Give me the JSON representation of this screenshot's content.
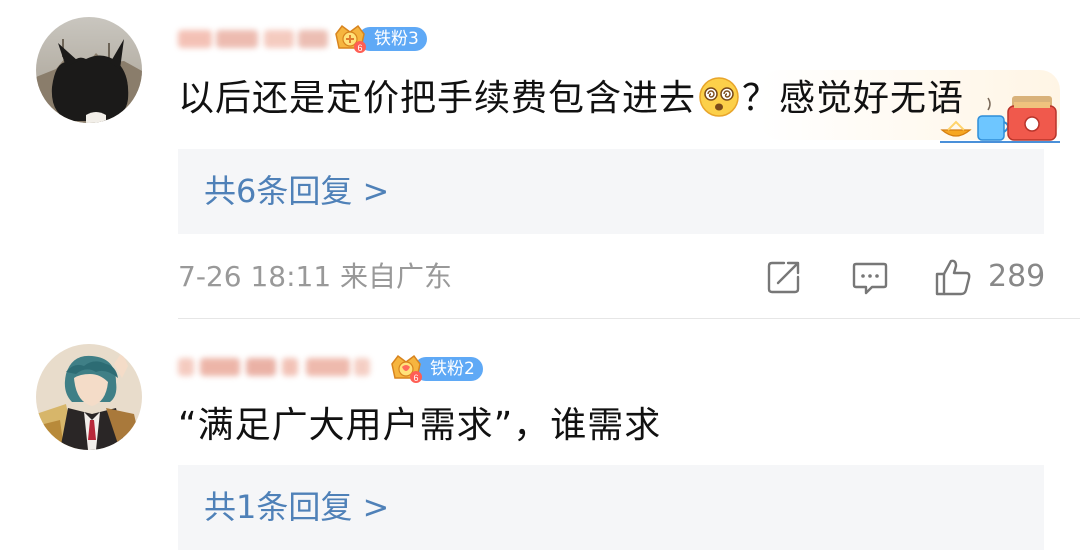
{
  "comments": [
    {
      "fan_badge": "铁粉3",
      "text_before": "以后还是定价把手续费包含进去",
      "text_after": "？感觉好无语",
      "emoji": "dizzy-face-emoji",
      "reply_link": "共6条回复 >",
      "timestamp": "7-26 18:11 来自广东",
      "like_count": "289"
    },
    {
      "fan_badge": "铁粉2",
      "text": "“满足广大用户需求”，谁需求",
      "reply_link": "共1条回复 >"
    }
  ],
  "colors": {
    "link": "#4f81b8",
    "badge": "#5fa9f6",
    "meta": "#999999",
    "reply_bg": "#f5f6f8"
  },
  "icons": [
    "crown-badge-icon",
    "forward-icon",
    "comment-icon",
    "like-icon",
    "dizzy-face-emoji",
    "breakfast-decoration-icon"
  ]
}
